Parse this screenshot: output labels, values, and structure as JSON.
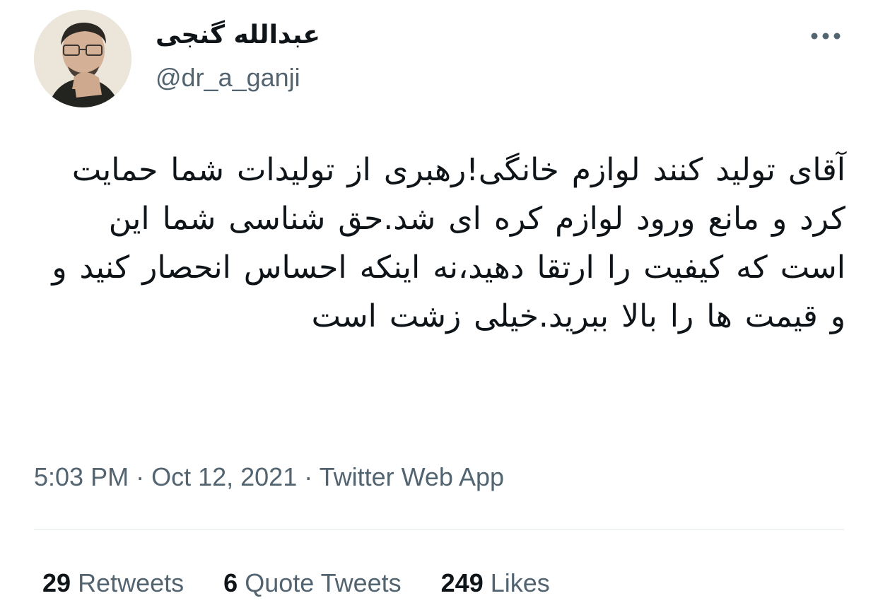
{
  "author": {
    "display_name": "عبدالله گنجی",
    "handle": "@dr_a_ganji"
  },
  "menu": {
    "icon": "more-horizontal-icon"
  },
  "tweet": {
    "text": "آقای تولید کنند لوازم خانگی!رهبری از تولیدات شما حمایت کرد و مانع ورود لوازم کره ای شد.حق شناسی شما این است که کیفیت را ارتقا دهید،نه اینکه احساس انحصار کنید و و قیمت ها را بالا ببرید.خیلی زشت است"
  },
  "meta": {
    "time": "5:03 PM",
    "separator": " · ",
    "date": "Oct 12, 2021",
    "source": "Twitter Web App"
  },
  "stats": {
    "retweets": {
      "count": "29",
      "label": "Retweets"
    },
    "quotes": {
      "count": "6",
      "label": "Quote Tweets"
    },
    "likes": {
      "count": "249",
      "label": "Likes"
    }
  },
  "colors": {
    "text": "#0f1419",
    "secondary": "#536471",
    "divider": "#eff3f4"
  }
}
